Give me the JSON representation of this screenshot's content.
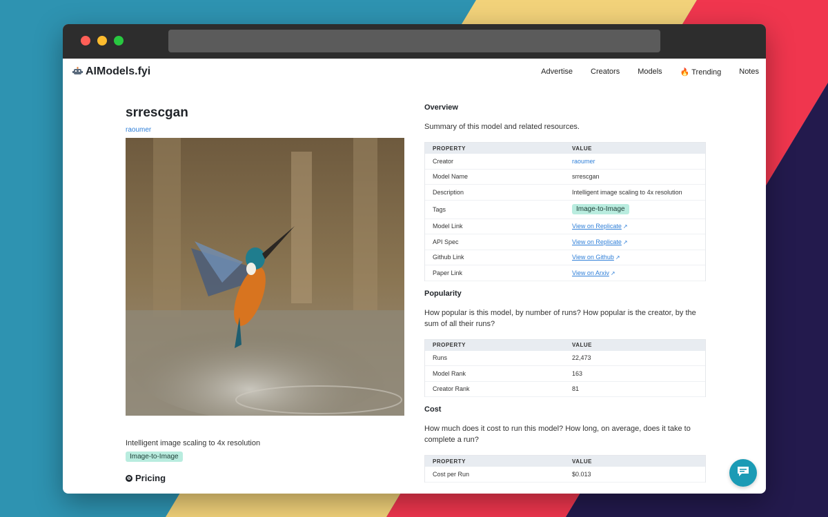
{
  "site": {
    "logo_icon": "robot-icon",
    "logo_text": "AIModels.fyi",
    "nav": [
      {
        "label": "Advertise"
      },
      {
        "label": "Creators"
      },
      {
        "label": "Models"
      },
      {
        "label": "🔥 Trending"
      },
      {
        "label": "Notes"
      }
    ]
  },
  "model": {
    "title": "srrescgan",
    "creator": "raoumer",
    "description": "Intelligent image scaling to 4x resolution",
    "tag": "Image-to-Image",
    "pricing_label": "Pricing",
    "info_icon_glyph": "❶"
  },
  "overview": {
    "title": "Overview",
    "subtitle": "Summary of this model and related resources.",
    "headers": [
      "PROPERTY",
      "VALUE"
    ],
    "rows": [
      {
        "property": "Creator",
        "value": "raoumer"
      },
      {
        "property": "Model Name",
        "value": "srrescgan"
      },
      {
        "property": "Description",
        "value": "Intelligent image scaling to 4x resolution"
      },
      {
        "property": "Tags",
        "value": "Image-to-Image"
      },
      {
        "property": "Model Link",
        "value": "View on Replicate"
      },
      {
        "property": "API Spec",
        "value": "View on Replicate"
      },
      {
        "property": "Github Link",
        "value": "View on Github"
      },
      {
        "property": "Paper Link",
        "value": "View on Arxiv"
      }
    ]
  },
  "popularity": {
    "title": "Popularity",
    "subtitle": "How popular is this model, by number of runs? How popular is the creator, by the sum of all their runs?",
    "headers": [
      "PROPERTY",
      "VALUE"
    ],
    "rows": [
      {
        "property": "Runs",
        "value": "22,473"
      },
      {
        "property": "Model Rank",
        "value": "163"
      },
      {
        "property": "Creator Rank",
        "value": "81"
      }
    ]
  },
  "cost": {
    "title": "Cost",
    "subtitle": "How much does it cost to run this model? How long, on average, does it take to complete a run?",
    "headers": [
      "PROPERTY",
      "VALUE"
    ],
    "rows": [
      {
        "property": "Cost per Run",
        "value": "$0.013"
      }
    ]
  },
  "colors": {
    "accent_link": "#2f7fd8",
    "tag_bg": "#b9ecdf",
    "chat_button": "#1b9bb5"
  }
}
